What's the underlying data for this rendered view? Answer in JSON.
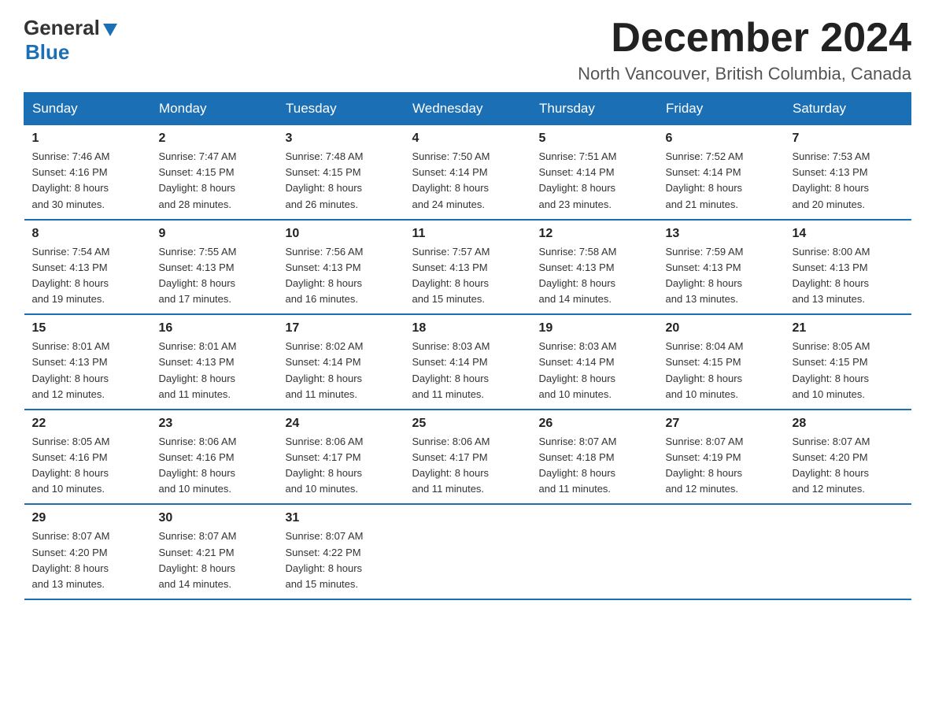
{
  "header": {
    "logo_general": "General",
    "logo_blue": "Blue",
    "month_title": "December 2024",
    "location": "North Vancouver, British Columbia, Canada"
  },
  "weekdays": [
    "Sunday",
    "Monday",
    "Tuesday",
    "Wednesday",
    "Thursday",
    "Friday",
    "Saturday"
  ],
  "weeks": [
    [
      {
        "day": "1",
        "sunrise": "7:46 AM",
        "sunset": "4:16 PM",
        "daylight": "8 hours and 30 minutes."
      },
      {
        "day": "2",
        "sunrise": "7:47 AM",
        "sunset": "4:15 PM",
        "daylight": "8 hours and 28 minutes."
      },
      {
        "day": "3",
        "sunrise": "7:48 AM",
        "sunset": "4:15 PM",
        "daylight": "8 hours and 26 minutes."
      },
      {
        "day": "4",
        "sunrise": "7:50 AM",
        "sunset": "4:14 PM",
        "daylight": "8 hours and 24 minutes."
      },
      {
        "day": "5",
        "sunrise": "7:51 AM",
        "sunset": "4:14 PM",
        "daylight": "8 hours and 23 minutes."
      },
      {
        "day": "6",
        "sunrise": "7:52 AM",
        "sunset": "4:14 PM",
        "daylight": "8 hours and 21 minutes."
      },
      {
        "day": "7",
        "sunrise": "7:53 AM",
        "sunset": "4:13 PM",
        "daylight": "8 hours and 20 minutes."
      }
    ],
    [
      {
        "day": "8",
        "sunrise": "7:54 AM",
        "sunset": "4:13 PM",
        "daylight": "8 hours and 19 minutes."
      },
      {
        "day": "9",
        "sunrise": "7:55 AM",
        "sunset": "4:13 PM",
        "daylight": "8 hours and 17 minutes."
      },
      {
        "day": "10",
        "sunrise": "7:56 AM",
        "sunset": "4:13 PM",
        "daylight": "8 hours and 16 minutes."
      },
      {
        "day": "11",
        "sunrise": "7:57 AM",
        "sunset": "4:13 PM",
        "daylight": "8 hours and 15 minutes."
      },
      {
        "day": "12",
        "sunrise": "7:58 AM",
        "sunset": "4:13 PM",
        "daylight": "8 hours and 14 minutes."
      },
      {
        "day": "13",
        "sunrise": "7:59 AM",
        "sunset": "4:13 PM",
        "daylight": "8 hours and 13 minutes."
      },
      {
        "day": "14",
        "sunrise": "8:00 AM",
        "sunset": "4:13 PM",
        "daylight": "8 hours and 13 minutes."
      }
    ],
    [
      {
        "day": "15",
        "sunrise": "8:01 AM",
        "sunset": "4:13 PM",
        "daylight": "8 hours and 12 minutes."
      },
      {
        "day": "16",
        "sunrise": "8:01 AM",
        "sunset": "4:13 PM",
        "daylight": "8 hours and 11 minutes."
      },
      {
        "day": "17",
        "sunrise": "8:02 AM",
        "sunset": "4:14 PM",
        "daylight": "8 hours and 11 minutes."
      },
      {
        "day": "18",
        "sunrise": "8:03 AM",
        "sunset": "4:14 PM",
        "daylight": "8 hours and 11 minutes."
      },
      {
        "day": "19",
        "sunrise": "8:03 AM",
        "sunset": "4:14 PM",
        "daylight": "8 hours and 10 minutes."
      },
      {
        "day": "20",
        "sunrise": "8:04 AM",
        "sunset": "4:15 PM",
        "daylight": "8 hours and 10 minutes."
      },
      {
        "day": "21",
        "sunrise": "8:05 AM",
        "sunset": "4:15 PM",
        "daylight": "8 hours and 10 minutes."
      }
    ],
    [
      {
        "day": "22",
        "sunrise": "8:05 AM",
        "sunset": "4:16 PM",
        "daylight": "8 hours and 10 minutes."
      },
      {
        "day": "23",
        "sunrise": "8:06 AM",
        "sunset": "4:16 PM",
        "daylight": "8 hours and 10 minutes."
      },
      {
        "day": "24",
        "sunrise": "8:06 AM",
        "sunset": "4:17 PM",
        "daylight": "8 hours and 10 minutes."
      },
      {
        "day": "25",
        "sunrise": "8:06 AM",
        "sunset": "4:17 PM",
        "daylight": "8 hours and 11 minutes."
      },
      {
        "day": "26",
        "sunrise": "8:07 AM",
        "sunset": "4:18 PM",
        "daylight": "8 hours and 11 minutes."
      },
      {
        "day": "27",
        "sunrise": "8:07 AM",
        "sunset": "4:19 PM",
        "daylight": "8 hours and 12 minutes."
      },
      {
        "day": "28",
        "sunrise": "8:07 AM",
        "sunset": "4:20 PM",
        "daylight": "8 hours and 12 minutes."
      }
    ],
    [
      {
        "day": "29",
        "sunrise": "8:07 AM",
        "sunset": "4:20 PM",
        "daylight": "8 hours and 13 minutes."
      },
      {
        "day": "30",
        "sunrise": "8:07 AM",
        "sunset": "4:21 PM",
        "daylight": "8 hours and 14 minutes."
      },
      {
        "day": "31",
        "sunrise": "8:07 AM",
        "sunset": "4:22 PM",
        "daylight": "8 hours and 15 minutes."
      },
      null,
      null,
      null,
      null
    ]
  ],
  "labels": {
    "sunrise": "Sunrise:",
    "sunset": "Sunset:",
    "daylight": "Daylight:"
  }
}
